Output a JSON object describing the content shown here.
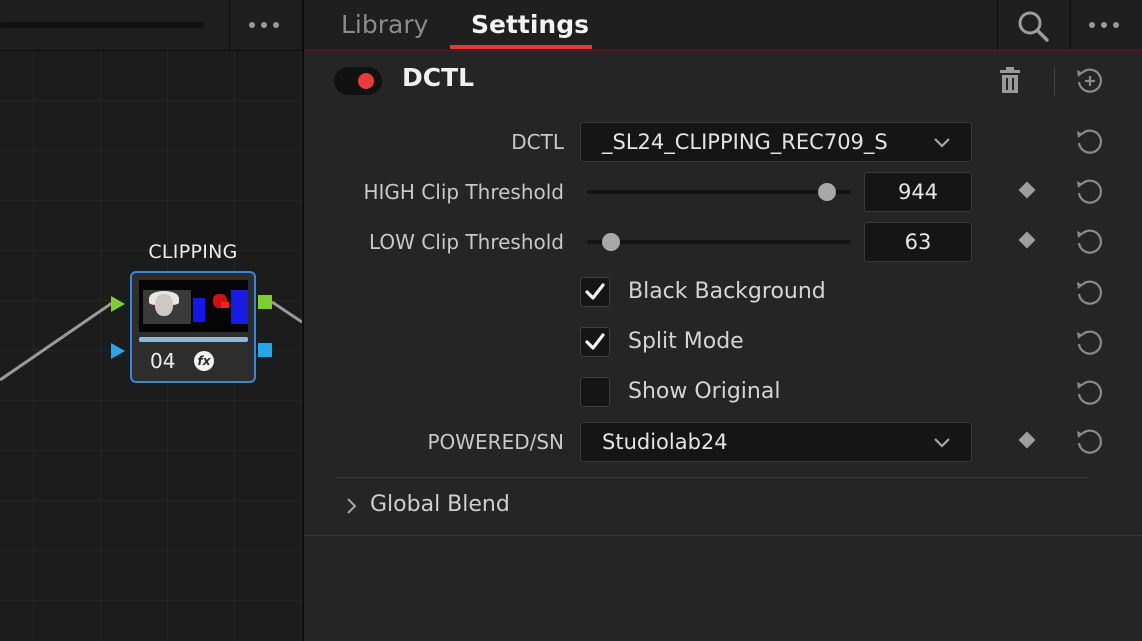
{
  "node_editor": {
    "node": {
      "title": "CLIPPING",
      "number": "04",
      "fx_badge": "fx"
    }
  },
  "tabs": [
    {
      "label": "Library",
      "active": false
    },
    {
      "label": "Settings",
      "active": true
    }
  ],
  "accent_color": "#e23b3b",
  "node_outline_color": "#3d86d6",
  "effect": {
    "title": "DCTL",
    "enabled": true,
    "params": {
      "dctl": {
        "label": "DCTL",
        "value": "_SL24_CLIPPING_REC709_S"
      },
      "high_clip": {
        "label": "HIGH Clip Threshold",
        "value": "944",
        "slider_fraction": 0.94
      },
      "low_clip": {
        "label": "LOW Clip Threshold",
        "value": "63",
        "slider_fraction": 0.06
      },
      "black_background": {
        "label": "Black Background",
        "checked": true
      },
      "split_mode": {
        "label": "Split Mode",
        "checked": true
      },
      "show_original": {
        "label": "Show Original",
        "checked": false
      },
      "powered": {
        "label": "POWERED/SN",
        "value": "Studiolab24"
      }
    }
  },
  "global_blend": {
    "label": "Global Blend",
    "expanded": false
  },
  "icons": [
    "more-icon",
    "search-icon",
    "trash-icon",
    "add-reset-icon",
    "reset-icon",
    "chevron-down-icon",
    "chevron-right-icon",
    "keyframe-diamond-icon",
    "checkmark-icon"
  ]
}
